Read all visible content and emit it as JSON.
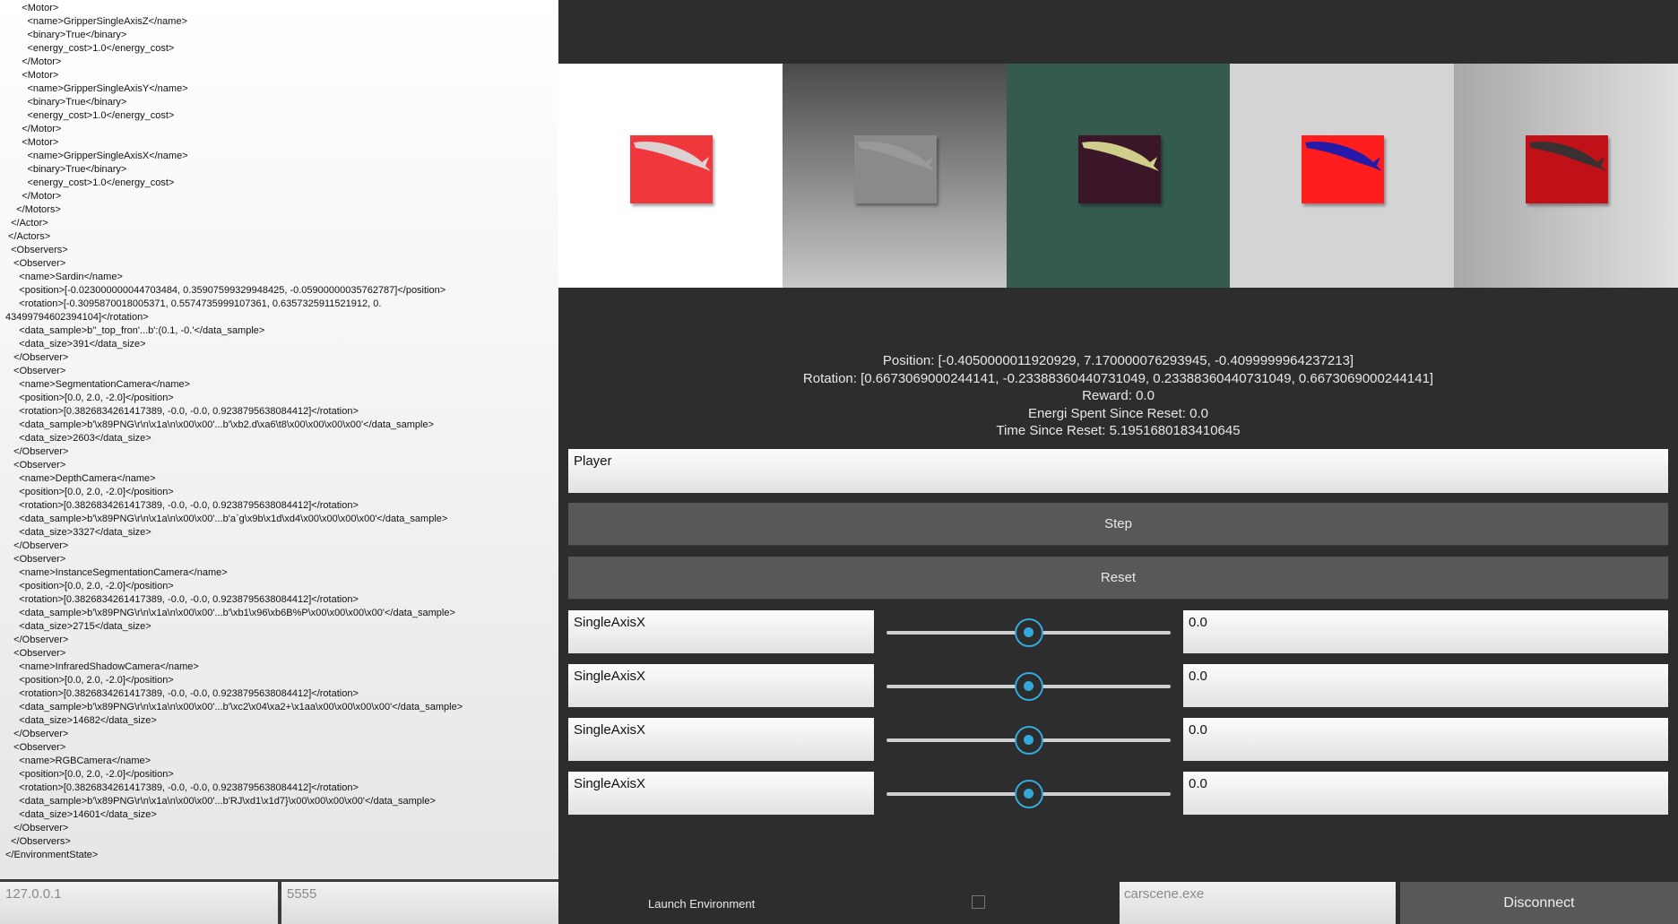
{
  "xml_lines": [
    "      <Motor>",
    "        <name>GripperSingleAxisZ</name>",
    "        <binary>True</binary>",
    "        <energy_cost>1.0</energy_cost>",
    "      </Motor>",
    "      <Motor>",
    "        <name>GripperSingleAxisY</name>",
    "        <binary>True</binary>",
    "        <energy_cost>1.0</energy_cost>",
    "      </Motor>",
    "      <Motor>",
    "        <name>GripperSingleAxisX</name>",
    "        <binary>True</binary>",
    "        <energy_cost>1.0</energy_cost>",
    "      </Motor>",
    "    </Motors>",
    "  </Actor>",
    " </Actors>",
    "  <Observers>",
    "   <Observer>",
    "     <name>Sardin</name>",
    "     <position>[-0.023000000044703484, 0.35907599329948425, -0.05900000035762787]</position>",
    "     <rotation>[-0.3095870018005371, 0.5574735999107361, 0.6357325911521912, 0.",
    "43499794602394104]</rotation>",
    "     <data_sample>b''_top_fron'...b':(0.1, -0.'</data_sample>",
    "     <data_size>391</data_size>",
    "   </Observer>",
    "   <Observer>",
    "     <name>SegmentationCamera</name>",
    "     <position>[0.0, 2.0, -2.0]</position>",
    "     <rotation>[0.3826834261417389, -0.0, -0.0, 0.9238795638084412]</rotation>",
    "     <data_sample>b'\\x89PNG\\r\\n\\x1a\\n\\x00\\x00'...b'\\xb2.d\\xa6\\t8\\x00\\x00\\x00\\x00'</data_sample>",
    "     <data_size>2603</data_size>",
    "   </Observer>",
    "   <Observer>",
    "     <name>DepthCamera</name>",
    "     <position>[0.0, 2.0, -2.0]</position>",
    "     <rotation>[0.3826834261417389, -0.0, -0.0, 0.9238795638084412]</rotation>",
    "     <data_sample>b'\\x89PNG\\r\\n\\x1a\\n\\x00\\x00'...b'a`g\\x9b\\x1d\\xd4\\x00\\x00\\x00\\x00'</data_sample>",
    "     <data_size>3327</data_size>",
    "   </Observer>",
    "   <Observer>",
    "     <name>InstanceSegmentationCamera</name>",
    "     <position>[0.0, 2.0, -2.0]</position>",
    "     <rotation>[0.3826834261417389, -0.0, -0.0, 0.9238795638084412]</rotation>",
    "     <data_sample>b'\\x89PNG\\r\\n\\x1a\\n\\x00\\x00'...b'\\xb1\\x96\\xb6B%P\\x00\\x00\\x00\\x00'</data_sample>",
    "     <data_size>2715</data_size>",
    "   </Observer>",
    "   <Observer>",
    "     <name>InfraredShadowCamera</name>",
    "     <position>[0.0, 2.0, -2.0]</position>",
    "     <rotation>[0.3826834261417389, -0.0, -0.0, 0.9238795638084412]</rotation>",
    "     <data_sample>b'\\x89PNG\\r\\n\\x1a\\n\\x00\\x00'...b'\\xc2\\x04\\xa2+\\x1aa\\x00\\x00\\x00\\x00'</data_sample>",
    "     <data_size>14682</data_size>",
    "   </Observer>",
    "   <Observer>",
    "     <name>RGBCamera</name>",
    "     <position>[0.0, 2.0, -2.0]</position>",
    "     <rotation>[0.3826834261417389, -0.0, -0.0, 0.9238795638084412]</rotation>",
    "     <data_sample>b'\\x89PNG\\r\\n\\x1a\\n\\x00\\x00'...b'RJ\\xd1\\x1d7}\\x00\\x00\\x00\\x00'</data_sample>",
    "     <data_size>14601</data_size>",
    "   </Observer>",
    "  </Observers>",
    "</EnvironmentState>"
  ],
  "connection": {
    "host": "127.0.0.1",
    "port": "5555"
  },
  "cameras": [
    {
      "bg": "#ffffff",
      "box": "#f0383c",
      "fish": "#d9d9d9"
    },
    {
      "bg": "linear-gradient(to bottom, #4a4a4a, #c8c8c8)",
      "box": "#8a8a8a",
      "fish": "#9a9a9a"
    },
    {
      "bg": "#355a4e",
      "box": "#3a1628",
      "fish": "#d8d890"
    },
    {
      "bg": "#d4d4d4",
      "box": "#ff1d1d",
      "fish": "#1a1ab0"
    },
    {
      "bg": "linear-gradient(to right, #a8a8a8, #e0e0e0)",
      "box": "#c01018",
      "fish": "#333333"
    }
  ],
  "info": {
    "position": "Position: [-0.4050000011920929, 7.170000076293945, -0.4099999964237213]",
    "rotation": "Rotation: [0.6673069000244141, -0.23388360440731049, 0.23388360440731049, 0.6673069000244141]",
    "reward": "Reward: 0.0",
    "energy": "Energi Spent Since Reset: 0.0",
    "time": "Time Since Reset: 5.1951680183410645"
  },
  "player_input": "Player",
  "step_label": "Step",
  "reset_label": "Reset",
  "axes": [
    {
      "name": "SingleAxisX",
      "value": "0.0",
      "slider": 0.5
    },
    {
      "name": "SingleAxisX",
      "value": "0.0",
      "slider": 0.5
    },
    {
      "name": "SingleAxisX",
      "value": "0.0",
      "slider": 0.5
    },
    {
      "name": "SingleAxisX",
      "value": "0.0",
      "slider": 0.5
    }
  ],
  "launch_label": "Launch Environment",
  "exe_input": "carscene.exe",
  "disconnect_label": "Disconnect"
}
